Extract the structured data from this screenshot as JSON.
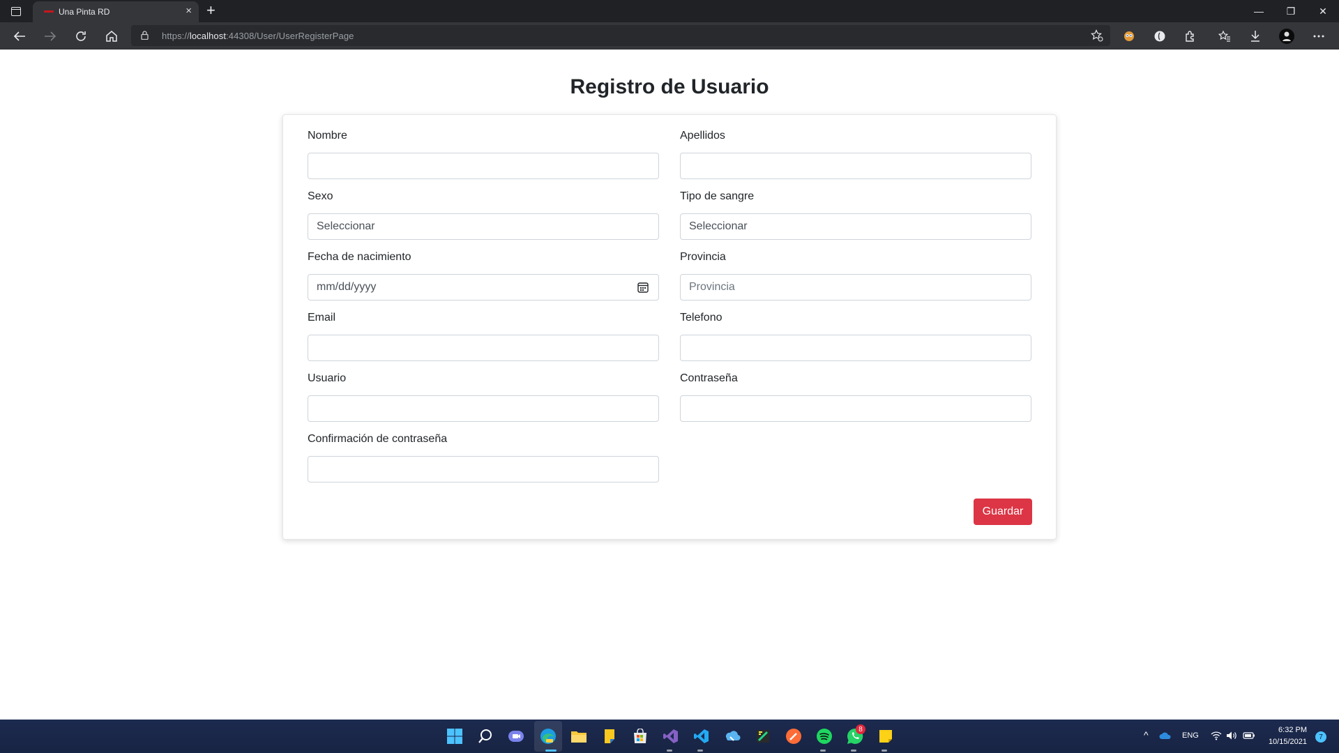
{
  "browser": {
    "tab_title": "Una Pinta RD",
    "tab_close": "×",
    "new_tab": "+",
    "url_prefix": "https://",
    "url_host": "localhost",
    "url_path": ":44308/User/UserRegisterPage",
    "window_controls": {
      "minimize": "—",
      "restore": "❐",
      "close": "✕"
    },
    "toolbar_icons": [
      "back-icon",
      "forward-icon",
      "reload-icon",
      "home-icon",
      "lock-icon",
      "favorites-add-icon"
    ],
    "extension_icons": [
      "extension-icon-1",
      "extension-icon-2",
      "puzzle-icon",
      "favorites-icon",
      "downloads-icon",
      "profile-avatar",
      "more-icon"
    ]
  },
  "page": {
    "title": "Registro de Usuario",
    "form": {
      "nombre": {
        "label": "Nombre",
        "value": ""
      },
      "apellidos": {
        "label": "Apellidos",
        "value": ""
      },
      "sexo": {
        "label": "Sexo",
        "value": "Seleccionar"
      },
      "tipo_sangre": {
        "label": "Tipo de sangre",
        "value": "Seleccionar"
      },
      "fecha_nacimiento": {
        "label": "Fecha de nacimiento",
        "placeholder": "mm/dd/yyyy"
      },
      "provincia": {
        "label": "Provincia",
        "placeholder": "Provincia"
      },
      "email": {
        "label": "Email",
        "value": ""
      },
      "telefono": {
        "label": "Telefono",
        "value": ""
      },
      "usuario": {
        "label": "Usuario",
        "value": ""
      },
      "contrasena": {
        "label": "Contraseña",
        "value": ""
      },
      "confirmacion": {
        "label": "Confirmación de contraseña",
        "value": ""
      }
    },
    "submit_label": "Guardar"
  },
  "taskbar": {
    "apps": [
      "windows-start-icon",
      "search-icon",
      "teams-icon",
      "edge-icon",
      "file-explorer-icon",
      "sticky-icon",
      "store-icon",
      "visual-studio-icon",
      "vscode-icon",
      "azure-icon",
      "dev-tool-icon",
      "postman-icon",
      "spotify-icon",
      "whatsapp-icon",
      "sticky-notes-icon"
    ],
    "whatsapp_badge": "8",
    "language": "ENG",
    "time": "6:32 PM",
    "date": "10/15/2021",
    "notification_count": "7",
    "colors": {
      "accent": "#dc3545",
      "taskbar": "#1c2a4f"
    }
  }
}
